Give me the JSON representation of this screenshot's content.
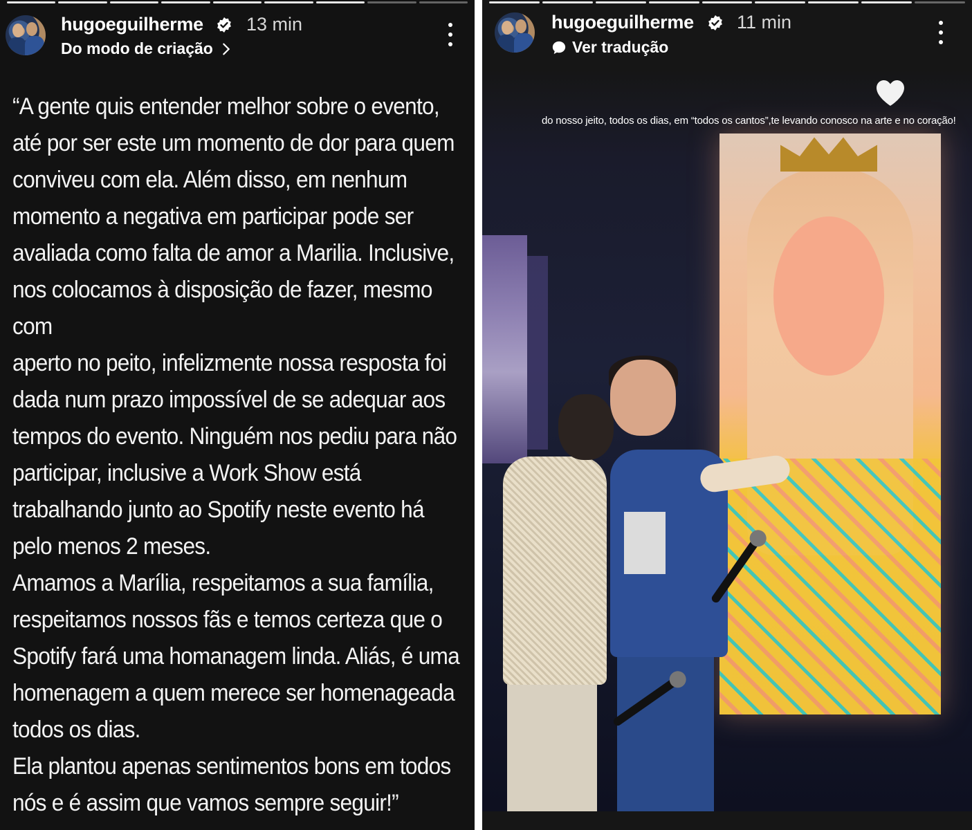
{
  "left_story": {
    "username": "hugoeguilherme",
    "time": "13 min",
    "subline": "Do modo de criação",
    "text": "“A gente quis entender melhor sobre o evento,\naté por ser este um momento de dor para quem\nconviveu com ela. Além disso, em nenhum\nmomento a negativa em participar pode ser\navaliada como falta de amor a Marilia. Inclusive,\nnos colocamos à disposição de fazer, mesmo com\naperto no peito, infelizmente nossa resposta foi\ndada num prazo impossível de se adequar aos\ntempos do evento. Ninguém nos pediu para não\nparticipar, inclusive a Work Show está\ntrabalhando junto ao Spotify neste evento há\npelo menos 2 meses.\nAmamos a Marília, respeitamos a sua família,\nrespeitamos nossos fãs e temos certeza que o\nSpotify fará uma homanagem linda. Aliás, é uma\nhomenagem a quem merece ser homenageada\ntodos os dias.\nEla plantou apenas sentimentos bons em todos\nnós e é assim que vamos sempre seguir!”",
    "icons": {
      "verified": "verified-badge-icon",
      "chevron": "chevron-right-icon",
      "more": "more-vertical-icon"
    }
  },
  "right_story": {
    "username": "hugoeguilherme",
    "time": "11 min",
    "subline": "Ver tradução",
    "caption": "do nosso jeito, todos os dias, em “todos os cantos”,te levando conosco na arte e no coração!",
    "icons": {
      "verified": "verified-badge-icon",
      "translate": "translate-bubble-icon",
      "heart": "heart-icon",
      "more": "more-vertical-icon"
    }
  },
  "colors": {
    "background_dark": "#121212",
    "text": "#ffffff",
    "muted": "#d8d8d8"
  }
}
